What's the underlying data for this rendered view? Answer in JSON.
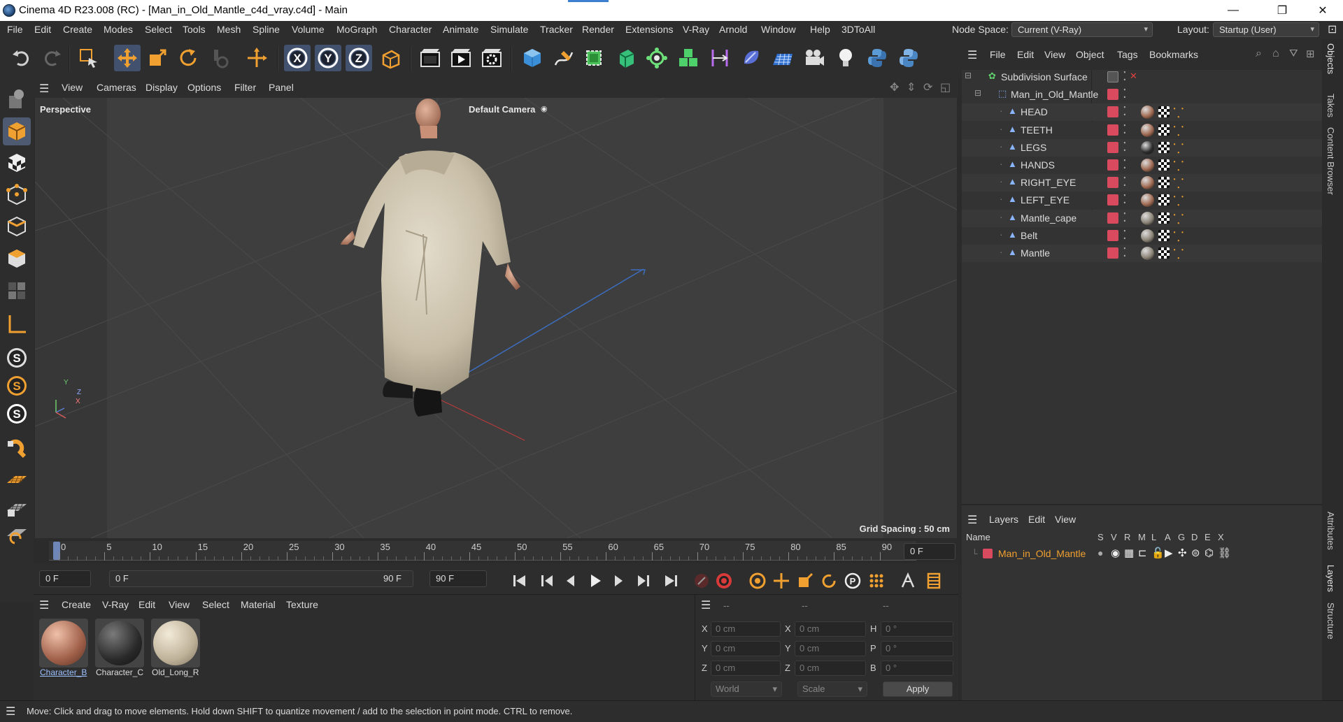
{
  "window": {
    "title": "Cinema 4D R23.008 (RC) - [Man_in_Old_Mantle_c4d_vray.c4d] - Main",
    "minimize": "—",
    "restore": "❐",
    "close": "✕"
  },
  "menubar": {
    "items": [
      "File",
      "Edit",
      "Create",
      "Modes",
      "Select",
      "Tools",
      "Mesh",
      "Spline",
      "Volume",
      "MoGraph",
      "Character",
      "Animate",
      "Simulate",
      "Tracker",
      "Render",
      "Extensions",
      "V-Ray",
      "Arnold",
      "Window",
      "Help",
      "3DToAll"
    ],
    "node_space_label": "Node Space:",
    "node_space_value": "Current (V-Ray)",
    "layout_label": "Layout:",
    "layout_value": "Startup (User)"
  },
  "viewport": {
    "menu": [
      "View",
      "Cameras",
      "Display",
      "Options",
      "Filter",
      "Panel"
    ],
    "view_name": "Perspective",
    "camera": "Default Camera",
    "grid_spacing": "Grid Spacing : 50 cm",
    "axis_y": "Y",
    "axis_z": "Z",
    "axis_x": "X"
  },
  "timeline": {
    "ticks": [
      "0",
      "5",
      "10",
      "15",
      "20",
      "25",
      "30",
      "35",
      "40",
      "45",
      "50",
      "55",
      "60",
      "65",
      "70",
      "75",
      "80",
      "85",
      "90"
    ],
    "current_frame_field": "0 F",
    "start_field": "0 F",
    "range_start": "0 F",
    "range_end": "90 F",
    "end_field": "90 F"
  },
  "material_manager": {
    "menu": [
      "Create",
      "V-Ray",
      "Edit",
      "View",
      "Select",
      "Material",
      "Texture"
    ],
    "materials": [
      {
        "label": "Character_B",
        "color": "#c9836a"
      },
      {
        "label": "Character_C",
        "color": "#3c3c3c"
      },
      {
        "label": "Old_Long_R",
        "color": "#cfc3ad"
      }
    ]
  },
  "coordinates": {
    "headers": [
      "--",
      "--",
      "--"
    ],
    "rows": [
      {
        "a": "X",
        "av": "0 cm",
        "b": "X",
        "bv": "0 cm",
        "c": "H",
        "cv": "0 °"
      },
      {
        "a": "Y",
        "av": "0 cm",
        "b": "Y",
        "bv": "0 cm",
        "c": "P",
        "cv": "0 °"
      },
      {
        "a": "Z",
        "av": "0 cm",
        "b": "Z",
        "bv": "0 cm",
        "c": "B",
        "cv": "0 °"
      }
    ],
    "space": "World",
    "mode": "Scale",
    "apply": "Apply"
  },
  "object_manager": {
    "menu": [
      "File",
      "Edit",
      "View",
      "Object",
      "Tags",
      "Bookmarks"
    ],
    "objects": [
      {
        "name": "Subdivision Surface",
        "level": 0
      },
      {
        "name": "Man_in_Old_Mantle",
        "level": 1
      },
      {
        "name": "HEAD",
        "level": 2,
        "mat": "#a06a52"
      },
      {
        "name": "TEETH",
        "level": 2,
        "mat": "#a06a52"
      },
      {
        "name": "LEGS",
        "level": 2,
        "mat": "#2d2d2d"
      },
      {
        "name": "HANDS",
        "level": 2,
        "mat": "#a06a52"
      },
      {
        "name": "RIGHT_EYE",
        "level": 2,
        "mat": "#a06a52"
      },
      {
        "name": "LEFT_EYE",
        "level": 2,
        "mat": "#a06a52"
      },
      {
        "name": "Mantle_cape",
        "level": 2,
        "mat": "#8c8578"
      },
      {
        "name": "Belt",
        "level": 2,
        "mat": "#8c8578"
      },
      {
        "name": "Mantle",
        "level": 2,
        "mat": "#8c8578"
      }
    ]
  },
  "layer_manager": {
    "menu": [
      "Layers",
      "Edit",
      "View"
    ],
    "name_header": "Name",
    "flag_headers": [
      "S",
      "V",
      "R",
      "M",
      "L",
      "A",
      "G",
      "D",
      "E",
      "X"
    ],
    "layers": [
      {
        "name": "Man_in_Old_Mantle",
        "color": "#d94a5f"
      }
    ]
  },
  "right_tabs": [
    "Objects",
    "Takes",
    "Content Browser",
    "Attributes",
    "Layers",
    "Structure"
  ],
  "status": "Move: Click and drag to move elements. Hold down SHIFT to quantize movement / add to the selection in point mode. CTRL to remove.",
  "colors": {
    "accent": "#e8a23a",
    "active": "#42526e",
    "layer_red": "#d94a5f"
  }
}
